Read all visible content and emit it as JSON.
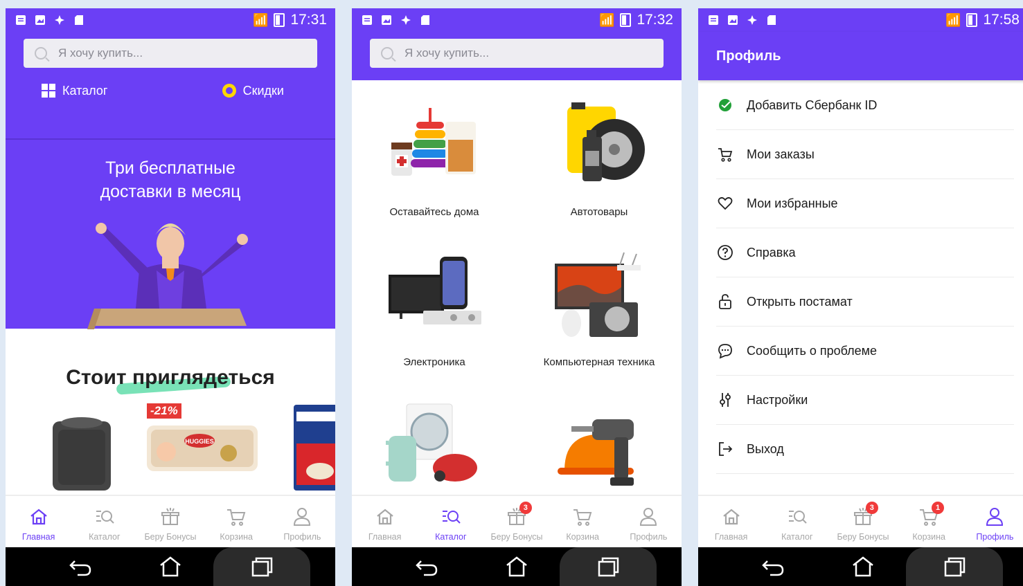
{
  "status": {
    "times": [
      "17:31",
      "17:32",
      "17:58"
    ]
  },
  "search": {
    "placeholder": "Я хочу купить..."
  },
  "home": {
    "catalog_label": "Каталог",
    "discounts_label": "Скидки",
    "banner_line1": "Три бесплатные",
    "banner_line2": "доставки в месяц",
    "section_title": "Стоит приглядеться",
    "discount_badge": "-21%"
  },
  "catalog": {
    "categories": [
      "Оставайтесь дома",
      "Автотовары",
      "Электроника",
      "Компьютерная техника",
      "",
      ""
    ]
  },
  "profile": {
    "title": "Профиль",
    "items": [
      {
        "label": "Добавить Сбербанк ID",
        "icon": "sberbank-icon"
      },
      {
        "label": "Мои заказы",
        "icon": "cart-orders-icon"
      },
      {
        "label": "Мои избранные",
        "icon": "heart-icon"
      },
      {
        "label": "Справка",
        "icon": "help-icon"
      },
      {
        "label": "Открыть постамат",
        "icon": "unlock-icon"
      },
      {
        "label": "Сообщить о проблеме",
        "icon": "chat-icon"
      },
      {
        "label": "Настройки",
        "icon": "sliders-icon"
      },
      {
        "label": "Выход",
        "icon": "logout-icon"
      }
    ]
  },
  "tabs": {
    "home": "Главная",
    "catalog": "Каталог",
    "bonuses": "Беру Бонусы",
    "cart": "Корзина",
    "profile": "Профиль"
  },
  "badges": {
    "bonuses": "3",
    "cart": "1"
  },
  "colors": {
    "brand": "#6b3ff5",
    "badge": "#f03a3a",
    "sber": "#21a038"
  }
}
